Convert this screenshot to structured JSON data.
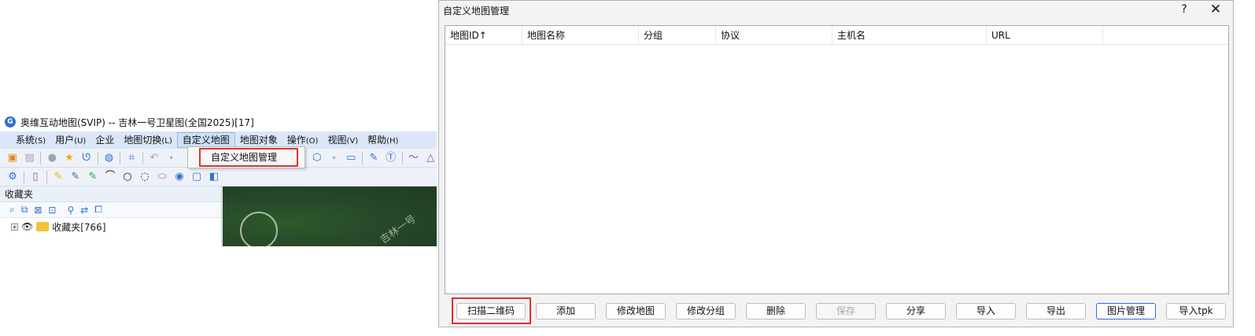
{
  "app": {
    "logo_text": "G",
    "title": "奥维互动地图(SVIP) -- 吉林一号卫星图(全国2025)[17]",
    "menu": [
      {
        "label": "系统",
        "key": "(S)"
      },
      {
        "label": "用户",
        "key": "(U)"
      },
      {
        "label": "企业",
        "key": ""
      },
      {
        "label": "地图切换",
        "key": "(L)"
      },
      {
        "label": "自定义地图",
        "key": ""
      },
      {
        "label": "地图对象",
        "key": ""
      },
      {
        "label": "操作",
        "key": "(O)"
      },
      {
        "label": "视图",
        "key": "(V)"
      },
      {
        "label": "帮助",
        "key": "(H)"
      }
    ],
    "dropdown_item": "自定义地图管理",
    "favorites": {
      "title": "收藏夹",
      "pin_icon": "⊓",
      "close_icon": "✕",
      "tree_item": "收藏夹[766]"
    },
    "map_watermark": "吉林一号"
  },
  "dialog": {
    "title": "自定义地图管理",
    "help": "?",
    "close": "✕",
    "columns": [
      "地图ID↑",
      "地图名称",
      "分组",
      "协议",
      "主机名",
      "URL"
    ],
    "buttons": {
      "scan_qr": "扫描二维码",
      "add": "添加",
      "edit_map": "修改地图",
      "edit_group": "修改分组",
      "delete": "删除",
      "save": "保存",
      "share": "分享",
      "import": "导入",
      "export": "导出",
      "image_manage": "图片管理",
      "import_tpk": "导入tpk"
    }
  },
  "colors": {
    "highlight_red": "#e03030",
    "accent_blue": "#2f6fd0",
    "menubar": "#dbe7f8"
  }
}
